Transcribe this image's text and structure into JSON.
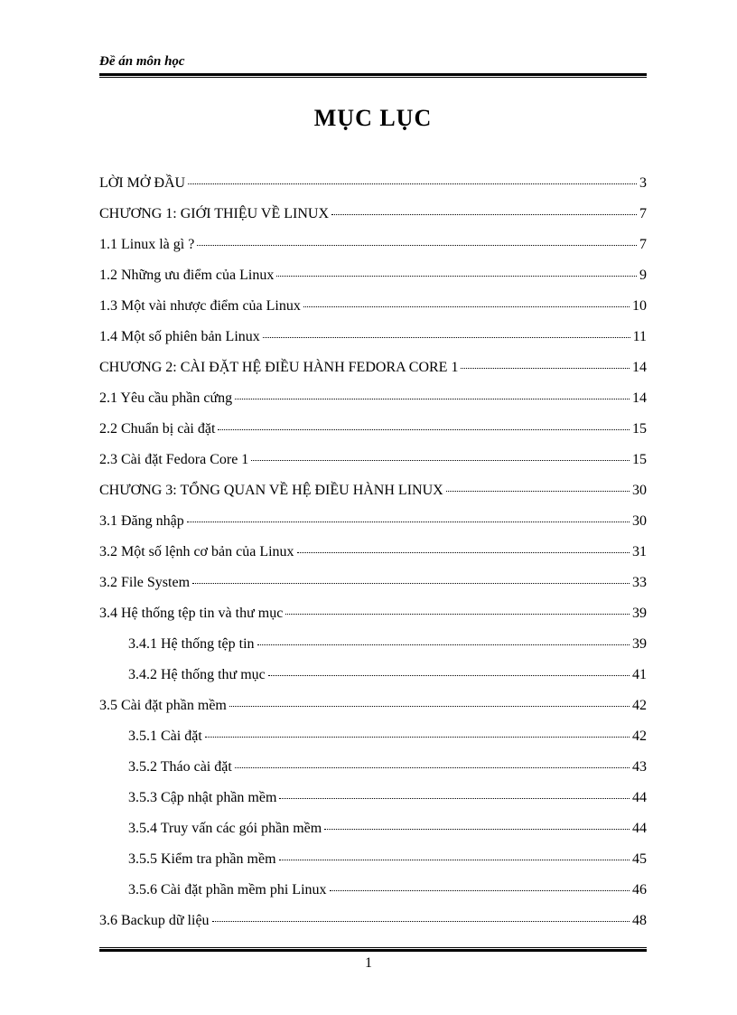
{
  "header": {
    "label": "Đề án môn học"
  },
  "title": "MỤC LỤC",
  "toc": [
    {
      "label": "LỜI MỞ ĐẦU",
      "page": "3",
      "indent": false
    },
    {
      "label": "CHƯƠNG 1: GIỚI THIỆU VỀ LINUX",
      "page": "7",
      "indent": false
    },
    {
      "label": "1.1 Linux là gì ?",
      "page": "7",
      "indent": false
    },
    {
      "label": "1.2 Những ưu điểm của Linux",
      "page": "9",
      "indent": false
    },
    {
      "label": "1.3 Một vài nhược điểm của Linux",
      "page": "10",
      "indent": false
    },
    {
      "label": "1.4 Một số phiên bản Linux",
      "page": "11",
      "indent": false
    },
    {
      "label": "CHƯƠNG 2: CÀI ĐẶT HỆ ĐIỀU HÀNH FEDORA CORE 1",
      "page": "14",
      "indent": false
    },
    {
      "label": "2.1 Yêu cầu phần cứng",
      "page": "14",
      "indent": false
    },
    {
      "label": "2.2 Chuẩn bị cài đặt",
      "page": "15",
      "indent": false
    },
    {
      "label": "2.3 Cài đặt Fedora Core 1",
      "page": "15",
      "indent": false
    },
    {
      "label": "CHƯƠNG 3: TỔNG QUAN VỀ HỆ ĐIỀU HÀNH LINUX",
      "page": "30",
      "indent": false
    },
    {
      "label": "3.1 Đăng nhập",
      "page": "30",
      "indent": false
    },
    {
      "label": "3.2 Một số lệnh cơ bản của Linux",
      "page": "31",
      "indent": false
    },
    {
      "label": "3.2 File System",
      "page": "33",
      "indent": false
    },
    {
      "label": "3.4 Hệ thống tệp tin và thư mục",
      "page": "39",
      "indent": false
    },
    {
      "label": "3.4.1 Hệ thống tệp tin",
      "page": "39",
      "indent": true
    },
    {
      "label": "3.4.2 Hệ thống thư mục",
      "page": "41",
      "indent": true
    },
    {
      "label": "3.5 Cài đặt phần mềm",
      "page": "42",
      "indent": false
    },
    {
      "label": "3.5.1 Cài đặt",
      "page": "42",
      "indent": true
    },
    {
      "label": "3.5.2 Tháo cài đặt",
      "page": "43",
      "indent": true
    },
    {
      "label": "3.5.3 Cập nhật phần mềm",
      "page": "44",
      "indent": true
    },
    {
      "label": "3.5.4 Truy vấn các gói phần mềm",
      "page": "44",
      "indent": true
    },
    {
      "label": "3.5.5 Kiểm tra phần mềm",
      "page": "45",
      "indent": true
    },
    {
      "label": "3.5.6 Cài đặt phần mềm phi Linux",
      "page": "46",
      "indent": true
    },
    {
      "label": "3.6 Backup dữ liệu",
      "page": "48",
      "indent": false
    }
  ],
  "footer": {
    "page_number": "1"
  }
}
